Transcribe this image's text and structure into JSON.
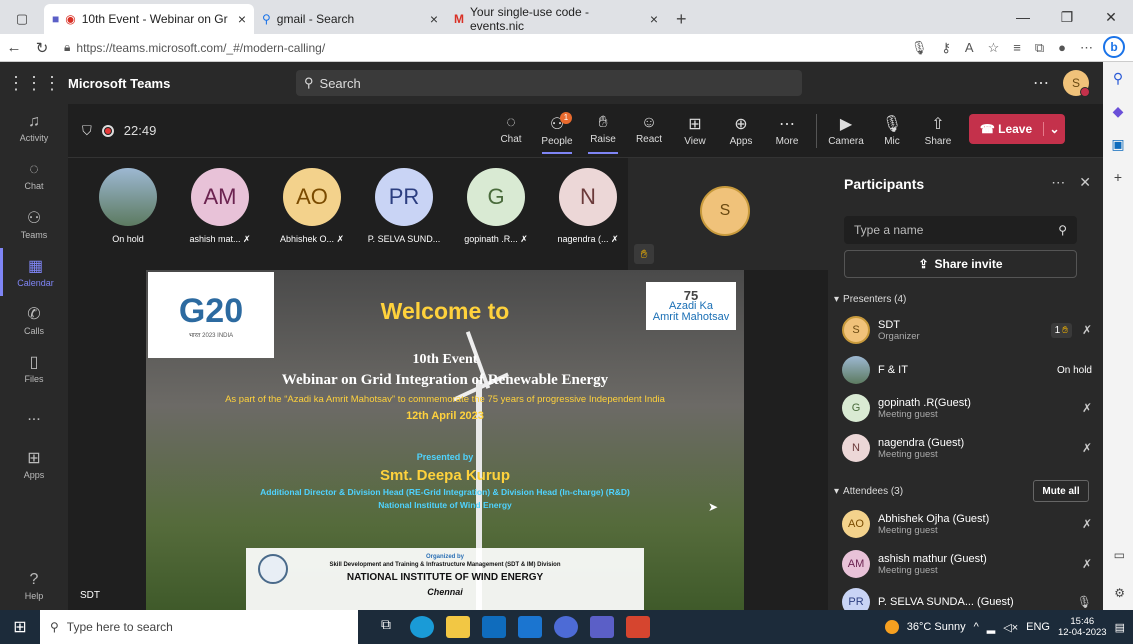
{
  "browser": {
    "tabs": [
      {
        "label": "10th Event - Webinar on Gr",
        "icon": "teams-icon",
        "active": true
      },
      {
        "label": "gmail - Search",
        "icon": "search-icon",
        "active": false
      },
      {
        "label": "Your single-use code - events.nic",
        "icon": "gmail-icon",
        "active": false
      }
    ],
    "url": "https://teams.microsoft.com/_#/modern-calling/"
  },
  "teams": {
    "app_name": "Microsoft Teams",
    "search_placeholder": "Search",
    "user_initial": "S",
    "rail": [
      {
        "label": "Activity",
        "icon": "bell-icon"
      },
      {
        "label": "Chat",
        "icon": "chat-icon"
      },
      {
        "label": "Teams",
        "icon": "teams-icon"
      },
      {
        "label": "Calendar",
        "icon": "calendar-icon"
      },
      {
        "label": "Calls",
        "icon": "phone-icon"
      },
      {
        "label": "Files",
        "icon": "file-icon"
      },
      {
        "label": "...",
        "icon": "more-icon"
      },
      {
        "label": "Apps",
        "icon": "apps-icon"
      },
      {
        "label": "Help",
        "icon": "help-icon"
      }
    ]
  },
  "meeting": {
    "timer": "22:49",
    "controls": [
      {
        "label": "Chat",
        "icon": "chat-icon"
      },
      {
        "label": "People",
        "icon": "people-icon",
        "badge": "1"
      },
      {
        "label": "Raise",
        "icon": "hand-icon"
      },
      {
        "label": "React",
        "icon": "smile-icon"
      },
      {
        "label": "View",
        "icon": "grid-icon"
      },
      {
        "label": "Apps",
        "icon": "plus-box-icon"
      },
      {
        "label": "More",
        "icon": "more-icon"
      }
    ],
    "media": [
      {
        "label": "Camera",
        "icon": "camera-off-icon"
      },
      {
        "label": "Mic",
        "icon": "mic-off-icon"
      },
      {
        "label": "Share",
        "icon": "share-icon"
      }
    ],
    "leave_label": "Leave"
  },
  "stage": {
    "tiles": [
      {
        "initials": "",
        "name": "On hold",
        "bg": "#6f8fae",
        "fg": "#ffffff"
      },
      {
        "initials": "AM",
        "name": "ashish mat...",
        "bg": "#e8c2d8",
        "fg": "#6b2350"
      },
      {
        "initials": "AO",
        "name": "Abhishek O...",
        "bg": "#f3d28c",
        "fg": "#7a4b00"
      },
      {
        "initials": "PR",
        "name": "P. SELVA SUND...",
        "bg": "#c9d4f5",
        "fg": "#2c3e80"
      },
      {
        "initials": "G",
        "name": "gopinath .R...",
        "bg": "#d9ead3",
        "fg": "#4a6b3c"
      },
      {
        "initials": "N",
        "name": "nagendra (...",
        "bg": "#ecd7d7",
        "fg": "#6b3a3a"
      }
    ],
    "self_initial": "S",
    "speaker_label": "SDT"
  },
  "slide": {
    "g20_text": "G20",
    "g20_sub": "भारत 2023 INDIA",
    "azadi_line1": "75",
    "azadi_line2": "Azadi Ka",
    "azadi_line3": "Amrit Mahotsav",
    "welcome": "Welcome to",
    "event": "10th Event",
    "webinar": "Webinar on Grid Integration of Renewable Energy",
    "part": "As part of the “Azadi ka Amrit Mahotsav” to commemorate the 75 years of progressive Independent India",
    "date": "12th April 2023",
    "presented_by": "Presented by",
    "presenter": "Smt. Deepa Kurup",
    "role": "Additional Director & Division Head (RE-Grid Integration) & Division Head (In-charge) (R&D)",
    "institute": "National Institute of Wind Energy",
    "organized_by": "Organized by",
    "division": "Skill Development and Training & Infrastructure Management (SDT & IM) Division",
    "niwe": "NATIONAL INSTITUTE OF WIND ENERGY",
    "city": "Chennai"
  },
  "participants": {
    "title": "Participants",
    "search_placeholder": "Type a name",
    "share_invite": "Share invite",
    "presenters_label": "Presenters (4)",
    "attendees_label": "Attendees (3)",
    "mute_all": "Mute all",
    "presenters": [
      {
        "initials": "S",
        "name": "SDT",
        "role": "Organizer",
        "bg": "#f0c27a",
        "fg": "#6b4a12",
        "status": "1"
      },
      {
        "initials": "",
        "name": "F & IT",
        "role": "",
        "bg": "#6f8fae",
        "fg": "#ffffff",
        "status": "On hold"
      },
      {
        "initials": "G",
        "name": "gopinath .R(Guest)",
        "role": "Meeting guest",
        "bg": "#d9ead3",
        "fg": "#4a6b3c",
        "status": ""
      },
      {
        "initials": "N",
        "name": "nagendra (Guest)",
        "role": "Meeting guest",
        "bg": "#ecd7d7",
        "fg": "#6b3a3a",
        "status": ""
      }
    ],
    "attendees": [
      {
        "initials": "AO",
        "name": "Abhishek Ojha (Guest)",
        "role": "Meeting guest",
        "bg": "#f3d28c",
        "fg": "#7a4b00"
      },
      {
        "initials": "AM",
        "name": "ashish mathur (Guest)",
        "role": "Meeting guest",
        "bg": "#e8c2d8",
        "fg": "#6b2350"
      },
      {
        "initials": "PR",
        "name": "P. SELVA SUNDA... (Guest)",
        "role": "",
        "bg": "#c9d4f5",
        "fg": "#2c3e80"
      }
    ]
  },
  "taskbar": {
    "search_placeholder": "Type here to search",
    "weather": "36°C  Sunny",
    "lang": "ENG",
    "time": "15:46",
    "date": "12-04-2023"
  }
}
